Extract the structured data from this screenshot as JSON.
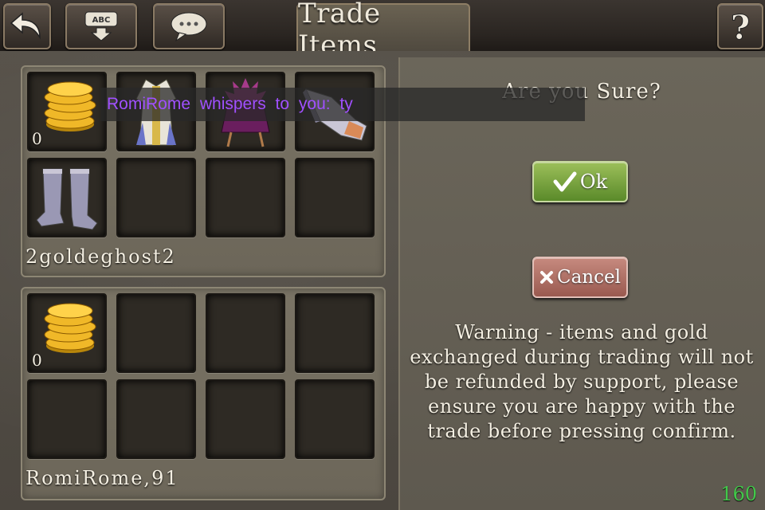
{
  "header": {
    "tab_title": "Trade Items",
    "buttons": [
      "back-icon",
      "abc-keyboard-icon",
      "chat-icon",
      "help-icon"
    ]
  },
  "your_offer": {
    "owner": "2goldeghost2",
    "gold_amount": "0",
    "items": [
      "gold-coins-icon",
      "robe-icon",
      "cape-icon",
      "gloves-icon",
      "boots-icon"
    ]
  },
  "their_offer": {
    "owner": "RomiRome,91",
    "gold_amount": "0",
    "items": [
      "gold-coins-icon"
    ]
  },
  "whisper": "RomiRome whispers to you: ty",
  "confirm": {
    "question": "Are you Sure?",
    "ok_label": "Ok",
    "cancel_label": "Cancel",
    "warning": "Warning - items and gold exchanged during trading will not be refunded by support, please ensure you are happy with the trade before pressing confirm."
  },
  "counter": "160",
  "colors": {
    "ok": "#7aa63e",
    "cancel": "#b27268",
    "whisper": "#a050ff",
    "counter": "#42c94a"
  }
}
